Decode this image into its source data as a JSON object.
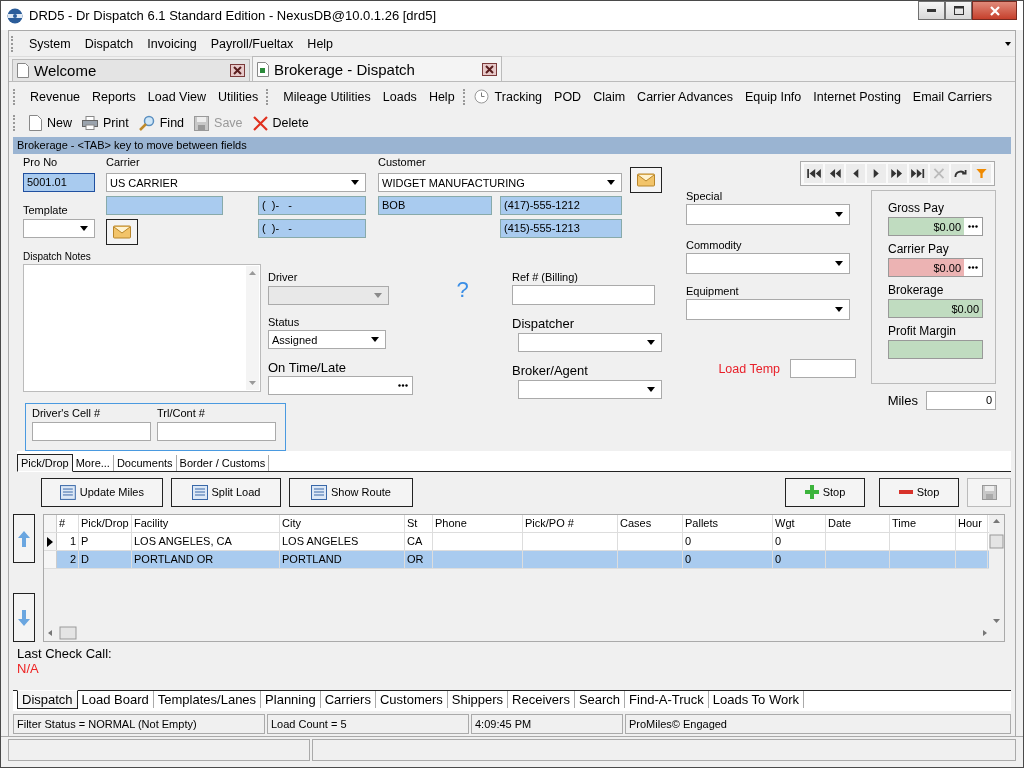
{
  "window": {
    "title": "DRD5 - Dr Dispatch 6.1 Standard Edition - NexusDB@10.0.1.26 [drd5]"
  },
  "menu": [
    "System",
    "Dispatch",
    "Invoicing",
    "Payroll/Fueltax",
    "Help"
  ],
  "doc_tabs": [
    {
      "label": "Welcome",
      "selected": false
    },
    {
      "label": "Brokerage - Dispatch",
      "selected": true
    }
  ],
  "toolbar_groups": [
    [
      "Revenue",
      "Reports",
      "Load View",
      "Utilities"
    ],
    [
      "Mileage Utilities",
      "Loads",
      "Help"
    ],
    [
      "Tracking",
      "POD",
      "Claim",
      "Carrier Advances",
      "Equip Info",
      "Internet Posting",
      "Email Carriers"
    ]
  ],
  "actions": [
    {
      "label": "New",
      "kind": "new",
      "disabled": false
    },
    {
      "label": "Print",
      "kind": "print",
      "disabled": false
    },
    {
      "label": "Find",
      "kind": "find",
      "disabled": false
    },
    {
      "label": "Save",
      "kind": "save",
      "disabled": true
    },
    {
      "label": "Delete",
      "kind": "delete",
      "disabled": false
    }
  ],
  "banner": "Brokerage - <TAB> key to move between fields",
  "form": {
    "pro_no": {
      "label": "Pro No",
      "value": "5001.01"
    },
    "carrier": {
      "label": "Carrier",
      "value": "US CARRIER"
    },
    "customer": {
      "label": "Customer",
      "value": "WIDGET MANUFACTURING"
    },
    "carrier_phones": [
      "(  )-   -",
      "(  )-   -"
    ],
    "contact": "BOB",
    "customer_phones": [
      "(417)-555-1212",
      "(415)-555-1213"
    ],
    "template": {
      "label": "Template"
    },
    "notes": {
      "label": "Dispatch Notes"
    },
    "driver": {
      "label": "Driver",
      "disabled": true
    },
    "status": {
      "label": "Status",
      "value": "Assigned"
    },
    "on_time": {
      "label": "On Time/Late"
    },
    "ref": {
      "label": "Ref # (Billing)"
    },
    "dispatcher": {
      "label": "Dispatcher"
    },
    "broker": {
      "label": "Broker/Agent"
    },
    "drivers_cell": {
      "label": "Driver's Cell #"
    },
    "trailer": {
      "label": "Trl/Cont #"
    },
    "special": {
      "label": "Special"
    },
    "commodity": {
      "label": "Commodity"
    },
    "equipment": {
      "label": "Equipment"
    },
    "load_temp": {
      "label": "Load Temp"
    },
    "pay": [
      {
        "label": "Gross Pay",
        "value": "$0.00",
        "color": "#c0dcc0",
        "has_button": true
      },
      {
        "label": "Carrier Pay",
        "value": "$0.00",
        "color": "#ecb3b3",
        "has_button": true
      },
      {
        "label": "Brokerage",
        "value": "$0.00",
        "color": "#c0dcc0",
        "has_button": false
      },
      {
        "label": "Profit Margin",
        "color": "#c0dcc0",
        "has_button": false
      }
    ],
    "miles": {
      "label": "Miles",
      "value": "0"
    },
    "help_glyph": "?"
  },
  "nav_buttons": [
    {
      "kind": "first",
      "disabled": false
    },
    {
      "kind": "prior-page",
      "disabled": false
    },
    {
      "kind": "prior",
      "disabled": false
    },
    {
      "kind": "next",
      "disabled": false
    },
    {
      "kind": "next-page",
      "disabled": false
    },
    {
      "kind": "last",
      "disabled": false
    },
    {
      "kind": "cancel",
      "disabled": true
    },
    {
      "kind": "refresh",
      "disabled": false
    },
    {
      "kind": "filter",
      "disabled": false
    }
  ],
  "sub_tabs": [
    {
      "label": "Pick/Drop",
      "selected": true
    },
    {
      "label": "More...",
      "selected": false
    },
    {
      "label": "Documents",
      "selected": false
    },
    {
      "label": "Border / Customs",
      "selected": false
    }
  ],
  "stop_tools": [
    "Update Miles",
    "Split Load",
    "Show Route"
  ],
  "stop_buttons": [
    {
      "label": "Stop",
      "kind": "add"
    },
    {
      "label": "Stop",
      "kind": "remove"
    }
  ],
  "table": {
    "columns": [
      "#",
      "Pick/Drop",
      "Facility",
      "City",
      "St",
      "Phone",
      "Pick/PO #",
      "Cases",
      "Pallets",
      "Wgt",
      "Date",
      "Time",
      "Hour"
    ],
    "rows": [
      {
        "current": true,
        "selected": false,
        "cells": [
          "1",
          "P",
          "LOS ANGELES, CA",
          "LOS ANGELES",
          "CA",
          "",
          "",
          "",
          "0",
          "0",
          "",
          "",
          ""
        ]
      },
      {
        "current": false,
        "selected": true,
        "cells": [
          "2",
          "D",
          "PORTLAND OR",
          "PORTLAND",
          "OR",
          "",
          "",
          "",
          "0",
          "0",
          "",
          "",
          ""
        ]
      }
    ]
  },
  "last_check_call": {
    "label": "Last Check Call:",
    "value": "N/A"
  },
  "bottom_tabs": [
    {
      "label": "Dispatch",
      "selected": true
    },
    {
      "label": "Load Board",
      "selected": false
    },
    {
      "label": "Templates/Lanes",
      "selected": false
    },
    {
      "label": "Planning",
      "selected": false
    },
    {
      "label": "Carriers",
      "selected": false
    },
    {
      "label": "Customers",
      "selected": false
    },
    {
      "label": "Shippers",
      "selected": false
    },
    {
      "label": "Receivers",
      "selected": false
    },
    {
      "label": "Search",
      "selected": false
    },
    {
      "label": "Find-A-Truck",
      "selected": false
    },
    {
      "label": "Loads To Work",
      "selected": false
    }
  ],
  "status_bar": [
    "Filter Status = NORMAL (Not Empty)",
    "Load Count = 5",
    "4:09:45 PM",
    "ProMiles© Engaged"
  ]
}
